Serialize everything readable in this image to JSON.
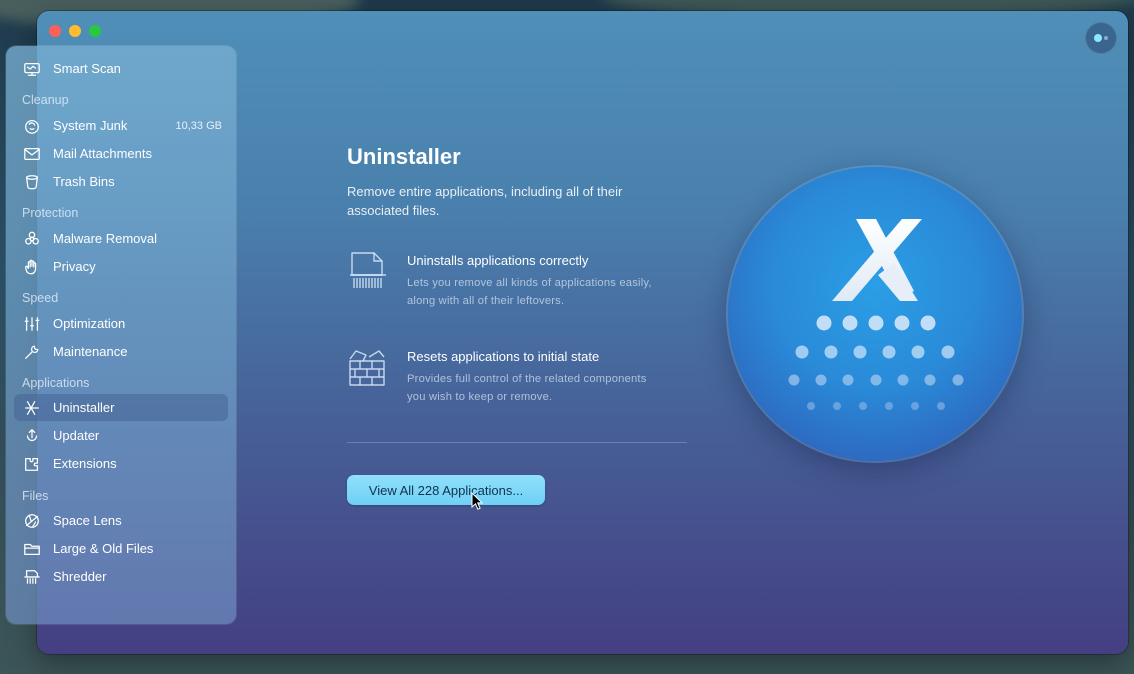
{
  "app": {
    "section_title": "Uninstaller",
    "description": "Remove entire applications, including all of their associated files."
  },
  "sidebar": {
    "top_item": {
      "label": "Smart Scan",
      "icon": "smart-scan-icon"
    },
    "sections": [
      {
        "title": "Cleanup",
        "items": [
          {
            "label": "System Junk",
            "icon": "system-junk-icon",
            "badge": "10,33 GB"
          },
          {
            "label": "Mail Attachments",
            "icon": "mail-icon"
          },
          {
            "label": "Trash Bins",
            "icon": "trash-icon"
          }
        ]
      },
      {
        "title": "Protection",
        "items": [
          {
            "label": "Malware Removal",
            "icon": "biohazard-icon"
          },
          {
            "label": "Privacy",
            "icon": "hand-icon"
          }
        ]
      },
      {
        "title": "Speed",
        "items": [
          {
            "label": "Optimization",
            "icon": "sliders-icon"
          },
          {
            "label": "Maintenance",
            "icon": "wrench-icon"
          }
        ]
      },
      {
        "title": "Applications",
        "items": [
          {
            "label": "Uninstaller",
            "icon": "uninstaller-icon",
            "active": true
          },
          {
            "label": "Updater",
            "icon": "updater-icon"
          },
          {
            "label": "Extensions",
            "icon": "extensions-icon"
          }
        ]
      },
      {
        "title": "Files",
        "items": [
          {
            "label": "Space Lens",
            "icon": "space-lens-icon"
          },
          {
            "label": "Large & Old Files",
            "icon": "folder-icon"
          },
          {
            "label": "Shredder",
            "icon": "shredder-icon"
          }
        ]
      }
    ]
  },
  "features": [
    {
      "title": "Uninstalls applications correctly",
      "desc_line1": "Lets you remove all kinds of applications easily,",
      "desc_line2": "along with all of their leftovers.",
      "icon": "shredded-doc-icon"
    },
    {
      "title": "Resets applications to initial state",
      "desc_line1": "Provides full control of the related components",
      "desc_line2": "you wish to keep or remove.",
      "icon": "brick-wall-icon"
    }
  ],
  "cta": {
    "label": "View All 228 Applications..."
  },
  "hero": {
    "icon": "uninstaller-hero-icon"
  },
  "colors": {
    "accent": "#6fd0f5",
    "window_top": "#4f8fb8",
    "window_bottom": "#443f82"
  }
}
